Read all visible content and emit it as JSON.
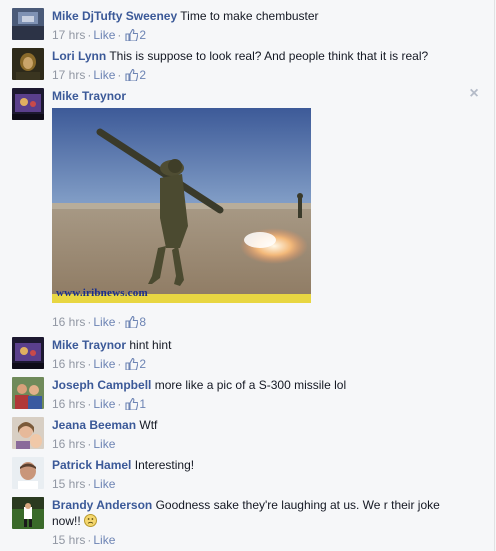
{
  "comments": [
    {
      "author": "Mike DjTufty Sweeney",
      "text": "Time to make chembuster",
      "time": "17 hrs",
      "like": "Like",
      "likes": "2"
    },
    {
      "author": "Lori Lynn",
      "text": "This is suppose to look real? And people think that it is real?",
      "time": "17 hrs",
      "like": "Like",
      "likes": "2"
    },
    {
      "author": "Mike Traynor",
      "text": "",
      "time": "16 hrs",
      "like": "Like",
      "likes": "8",
      "photo_caption": "www.iribnews.com"
    },
    {
      "author": "Mike Traynor",
      "text": "hint hint",
      "time": "16 hrs",
      "like": "Like",
      "likes": "2"
    },
    {
      "author": "Joseph Campbell",
      "text": "more like a pic of a S-300 missile lol",
      "time": "16 hrs",
      "like": "Like",
      "likes": "1"
    },
    {
      "author": "Jeana Beeman",
      "text": "Wtf",
      "time": "16 hrs",
      "like": "Like"
    },
    {
      "author": "Patrick Hamel",
      "text": "Interesting!",
      "time": "15 hrs",
      "like": "Like"
    },
    {
      "author": "Brandy Anderson",
      "text": "Goodness sake they're laughing at us. We r their joke now!!",
      "time": "15 hrs",
      "like": "Like"
    }
  ],
  "separator": "·",
  "icons": {
    "like": "thumbs-up-icon",
    "close": "close-icon",
    "emoji": "frown-emoji-icon"
  },
  "colors": {
    "author": "#3b5998",
    "meta": "#9197a3",
    "link": "#6d84b4",
    "background": "#f6f7f9"
  }
}
